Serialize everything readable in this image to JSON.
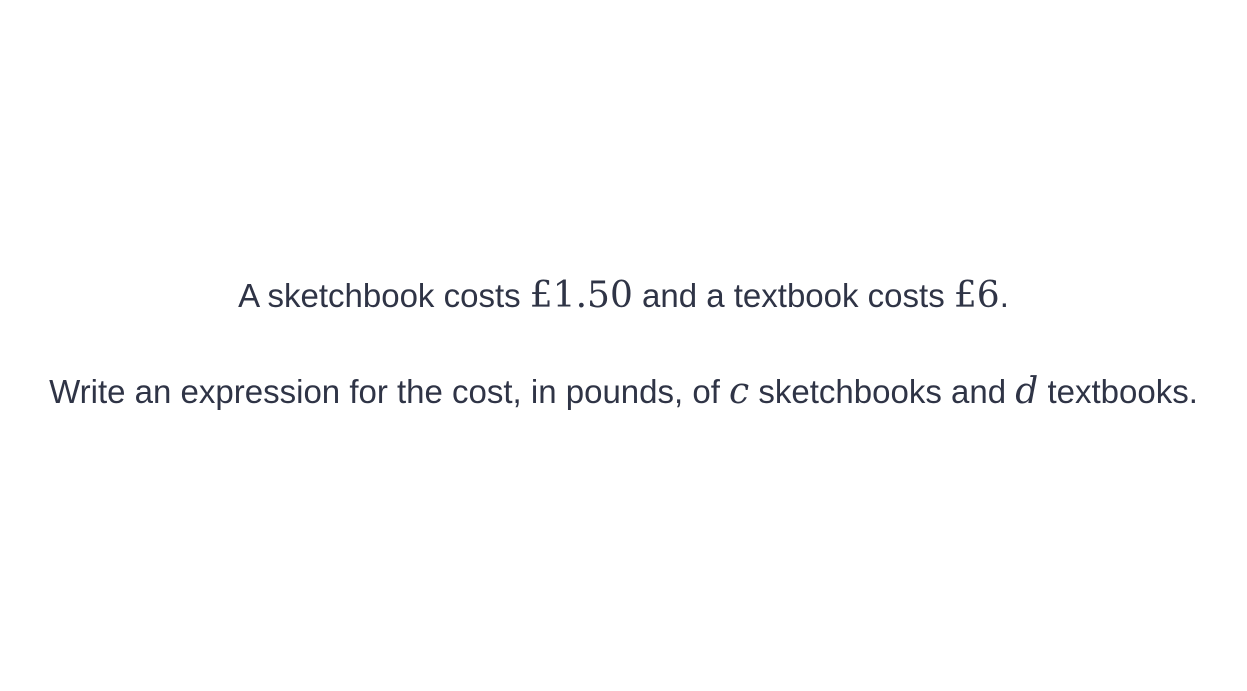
{
  "question": {
    "line1": {
      "text1": "A sketchbook costs",
      "price1": "£1.50",
      "text2": "and a textbook costs",
      "price2": "£6",
      "end": "."
    },
    "line2": {
      "text1": "Write an expression for the cost, in pounds, of",
      "var_c": "c",
      "text2": "sketchbooks and",
      "var_d": "d",
      "text3": "textbooks."
    }
  }
}
